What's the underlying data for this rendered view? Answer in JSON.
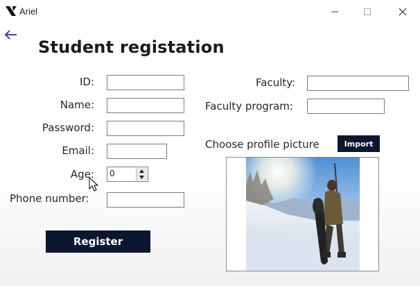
{
  "window": {
    "title": "Ariel",
    "app_icon": "ariel-logo-icon",
    "controls": [
      "minimize-icon",
      "maximize-icon",
      "close-icon"
    ]
  },
  "nav": {
    "back_icon": "back-arrow-icon"
  },
  "page": {
    "title": "Student registation"
  },
  "form": {
    "id_label": "ID:",
    "name_label": "Name:",
    "password_label": "Password:",
    "email_label": "Email:",
    "age_label": "Age:",
    "age_value": "0",
    "phone_label": "Phone number:",
    "faculty_label": "Faculty:",
    "faculty_program_label": "Faculty program:",
    "picture_label": "Choose profile picture",
    "import_label": "Import",
    "register_label": "Register"
  },
  "colors": {
    "button_bg": "#0d1631",
    "button_text": "#ffffff",
    "accent": "#1f2a7a"
  }
}
